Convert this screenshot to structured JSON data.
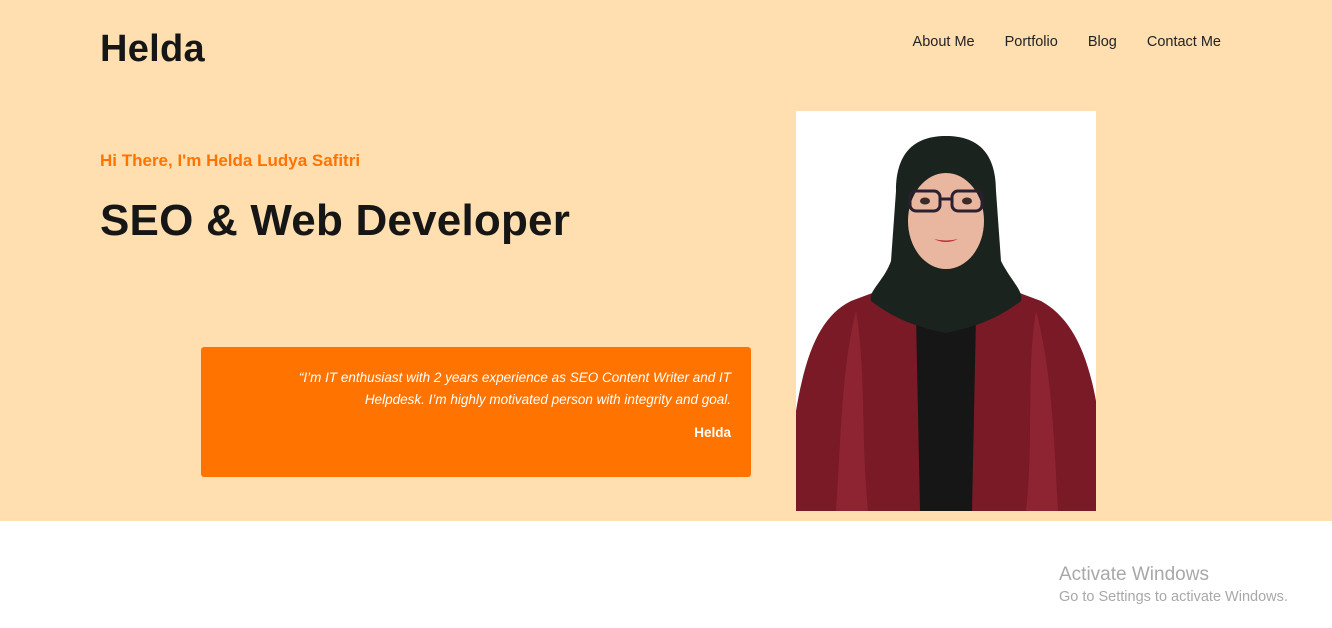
{
  "header": {
    "logo": "Helda",
    "nav": [
      "About Me",
      "Portfolio",
      "Blog",
      "Contact Me"
    ]
  },
  "hero": {
    "greeting": "Hi There, I'm Helda Ludya Safitri",
    "headline": "SEO & Web Developer",
    "quote": "“I’m IT enthusiast with 2 years experience as SEO Content Writer and IT Helpdesk. I’m highly motivated person with integrity and goal.",
    "quote_author": "Helda"
  },
  "watermark": {
    "title": "Activate Windows",
    "subtitle": "Go to Settings to activate Windows."
  },
  "colors": {
    "hero_bg": "#ffdfb0",
    "accent": "#ff7300",
    "text_dark": "#161616"
  }
}
